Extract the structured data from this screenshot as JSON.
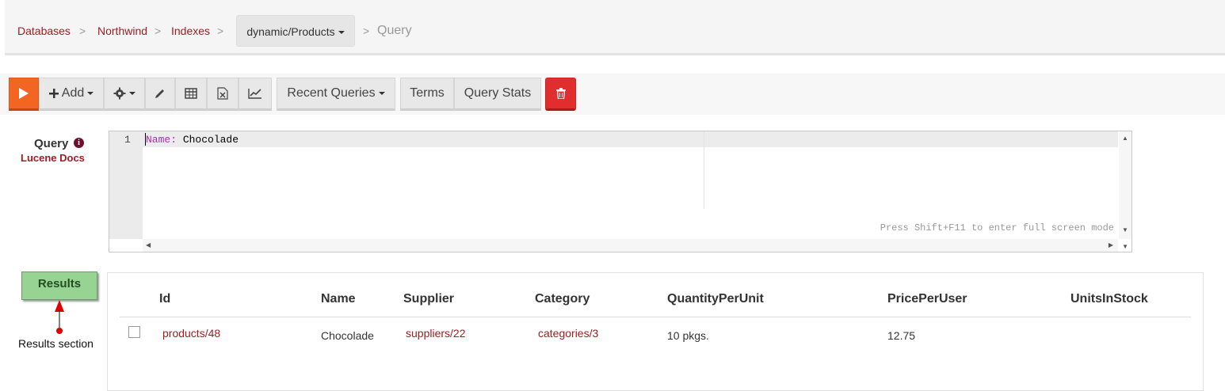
{
  "breadcrumb": {
    "items": [
      "Databases",
      "Northwind",
      "Indexes"
    ],
    "separator": ">",
    "index_dropdown": "dynamic/Products",
    "current": "Query"
  },
  "toolbar": {
    "run_icon": "play-icon",
    "add_label": "Add",
    "settings_icon": "gear-icon",
    "edit_icon": "pencil-icon",
    "table_icon": "table-icon",
    "excel_icon": "excel-export-icon",
    "chart_icon": "line-chart-icon",
    "recent_queries_label": "Recent Queries",
    "terms_label": "Terms",
    "query_stats_label": "Query Stats",
    "delete_icon": "trash-icon"
  },
  "query": {
    "label": "Query",
    "info_icon": "info-icon",
    "docs_link": "Lucene Docs",
    "line_number": "1",
    "field": "Name:",
    "value": " Chocolade",
    "hint": "Press Shift+F11 to enter full screen mode"
  },
  "results": {
    "button_label": "Results",
    "annotation_label": "Results section",
    "columns": [
      "Id",
      "Name",
      "Supplier",
      "Category",
      "QuantityPerUnit",
      "PricePerUser",
      "UnitsInStock"
    ],
    "rows": [
      {
        "id": "products/48",
        "name": "Chocolade",
        "supplier": "suppliers/22",
        "category": "categories/3",
        "quantity_per_unit": "10 pkgs.",
        "price_per_user": "12.75",
        "units_in_stock": ""
      }
    ]
  },
  "colors": {
    "accent": "#a01c22",
    "run_button": "#f26522",
    "delete_button": "#e02e2e",
    "results_button": "#97d493"
  }
}
